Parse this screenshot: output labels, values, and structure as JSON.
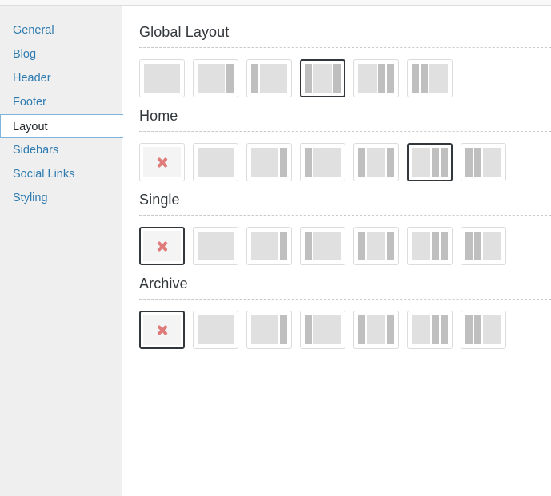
{
  "sidebar": {
    "items": [
      {
        "label": "General",
        "selected": false
      },
      {
        "label": "Blog",
        "selected": false
      },
      {
        "label": "Header",
        "selected": false
      },
      {
        "label": "Footer",
        "selected": false
      },
      {
        "label": "Layout",
        "selected": true
      },
      {
        "label": "Sidebars",
        "selected": false
      },
      {
        "label": "Social Links",
        "selected": false
      },
      {
        "label": "Styling",
        "selected": false
      }
    ]
  },
  "colors": {
    "nav_link": "#2e7bb0",
    "nav_selected_border": "#7eb3da",
    "sidebar_bg": "#efefef",
    "heading": "#32373c",
    "divider": "#c9c9c9",
    "thumb_border": "#dcdcdc",
    "thumb_selected_border": "#32373c",
    "block_content": "#e0e0e0",
    "block_sidebar": "#bfbfbf",
    "none_icon": "#e07b7b"
  },
  "sections": [
    {
      "title": "Global Layout",
      "options": [
        {
          "name": "full-width",
          "icon": "layout-full-width",
          "columns": [
            "content"
          ],
          "selected": false
        },
        {
          "name": "content-right-sidebar",
          "icon": "layout-content-sidebar",
          "columns": [
            "content",
            "side"
          ],
          "selected": false
        },
        {
          "name": "left-sidebar-content",
          "icon": "layout-sidebar-content",
          "columns": [
            "side",
            "content"
          ],
          "selected": false
        },
        {
          "name": "sidebar-content-sidebar",
          "icon": "layout-sidebar-content-sidebar",
          "columns": [
            "side",
            "content",
            "side"
          ],
          "selected": true
        },
        {
          "name": "content-two-right-sidebars",
          "icon": "layout-content-side-side",
          "columns": [
            "content",
            "side",
            "side"
          ],
          "selected": false
        },
        {
          "name": "two-left-sidebars-content",
          "icon": "layout-side-side-content",
          "columns": [
            "side",
            "side",
            "content"
          ],
          "selected": false
        }
      ]
    },
    {
      "title": "Home",
      "options": [
        {
          "name": "inherit-none",
          "icon": "none-x-icon",
          "columns": [],
          "selected": false
        },
        {
          "name": "full-width",
          "icon": "layout-full-width",
          "columns": [
            "content"
          ],
          "selected": false
        },
        {
          "name": "content-right-sidebar",
          "icon": "layout-content-sidebar",
          "columns": [
            "content",
            "side"
          ],
          "selected": false
        },
        {
          "name": "left-sidebar-content",
          "icon": "layout-sidebar-content",
          "columns": [
            "side",
            "content"
          ],
          "selected": false
        },
        {
          "name": "sidebar-content-sidebar",
          "icon": "layout-sidebar-content-sidebar",
          "columns": [
            "side",
            "content",
            "side"
          ],
          "selected": false
        },
        {
          "name": "content-two-right-sidebars",
          "icon": "layout-content-side-side",
          "columns": [
            "content",
            "side",
            "side"
          ],
          "selected": true
        },
        {
          "name": "two-left-sidebars-content",
          "icon": "layout-side-side-content",
          "columns": [
            "side",
            "side",
            "content"
          ],
          "selected": false
        }
      ]
    },
    {
      "title": "Single",
      "options": [
        {
          "name": "inherit-none",
          "icon": "none-x-icon",
          "columns": [],
          "selected": true
        },
        {
          "name": "full-width",
          "icon": "layout-full-width",
          "columns": [
            "content"
          ],
          "selected": false
        },
        {
          "name": "content-right-sidebar",
          "icon": "layout-content-sidebar",
          "columns": [
            "content",
            "side"
          ],
          "selected": false
        },
        {
          "name": "left-sidebar-content",
          "icon": "layout-sidebar-content",
          "columns": [
            "side",
            "content"
          ],
          "selected": false
        },
        {
          "name": "sidebar-content-sidebar",
          "icon": "layout-sidebar-content-sidebar",
          "columns": [
            "side",
            "content",
            "side"
          ],
          "selected": false
        },
        {
          "name": "content-two-right-sidebars",
          "icon": "layout-content-side-side",
          "columns": [
            "content",
            "side",
            "side"
          ],
          "selected": false
        },
        {
          "name": "two-left-sidebars-content",
          "icon": "layout-side-side-content",
          "columns": [
            "side",
            "side",
            "content"
          ],
          "selected": false
        }
      ]
    },
    {
      "title": "Archive",
      "options": [
        {
          "name": "inherit-none",
          "icon": "none-x-icon",
          "columns": [],
          "selected": true
        },
        {
          "name": "full-width",
          "icon": "layout-full-width",
          "columns": [
            "content"
          ],
          "selected": false
        },
        {
          "name": "content-right-sidebar",
          "icon": "layout-content-sidebar",
          "columns": [
            "content",
            "side"
          ],
          "selected": false
        },
        {
          "name": "left-sidebar-content",
          "icon": "layout-sidebar-content",
          "columns": [
            "side",
            "content"
          ],
          "selected": false
        },
        {
          "name": "sidebar-content-sidebar",
          "icon": "layout-sidebar-content-sidebar",
          "columns": [
            "side",
            "content",
            "side"
          ],
          "selected": false
        },
        {
          "name": "content-two-right-sidebars",
          "icon": "layout-content-side-side",
          "columns": [
            "content",
            "side",
            "side"
          ],
          "selected": false
        },
        {
          "name": "two-left-sidebars-content",
          "icon": "layout-side-side-content",
          "columns": [
            "side",
            "side",
            "content"
          ],
          "selected": false
        }
      ]
    }
  ]
}
